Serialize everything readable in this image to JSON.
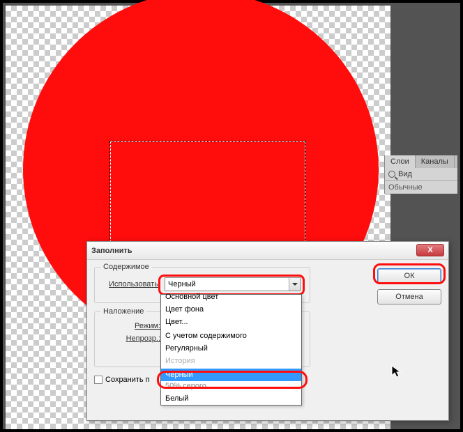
{
  "panel": {
    "tab1": "Слои",
    "tab2": "Каналы",
    "view": "Вид",
    "mode": "Обычные"
  },
  "dialog": {
    "title": "Заполнить",
    "close": "X",
    "ok": "ОК",
    "cancel": "Отмена",
    "content_legend": "Содержимое",
    "use_label": "Использовать:",
    "combo_value": "Черный",
    "blend_legend": "Наложение",
    "mode_label": "Режим:",
    "opacity_label": "Непрозр.:",
    "preserve": "Сохранить п",
    "dropdown": {
      "o0": "Основной цвет",
      "o1": "Цвет фона",
      "o2": "Цвет...",
      "o3": "С учетом содержимого",
      "o4": "Регулярный",
      "o5": "История",
      "o6": "Черный",
      "o7": "50% серого",
      "o8": "Белый"
    }
  }
}
